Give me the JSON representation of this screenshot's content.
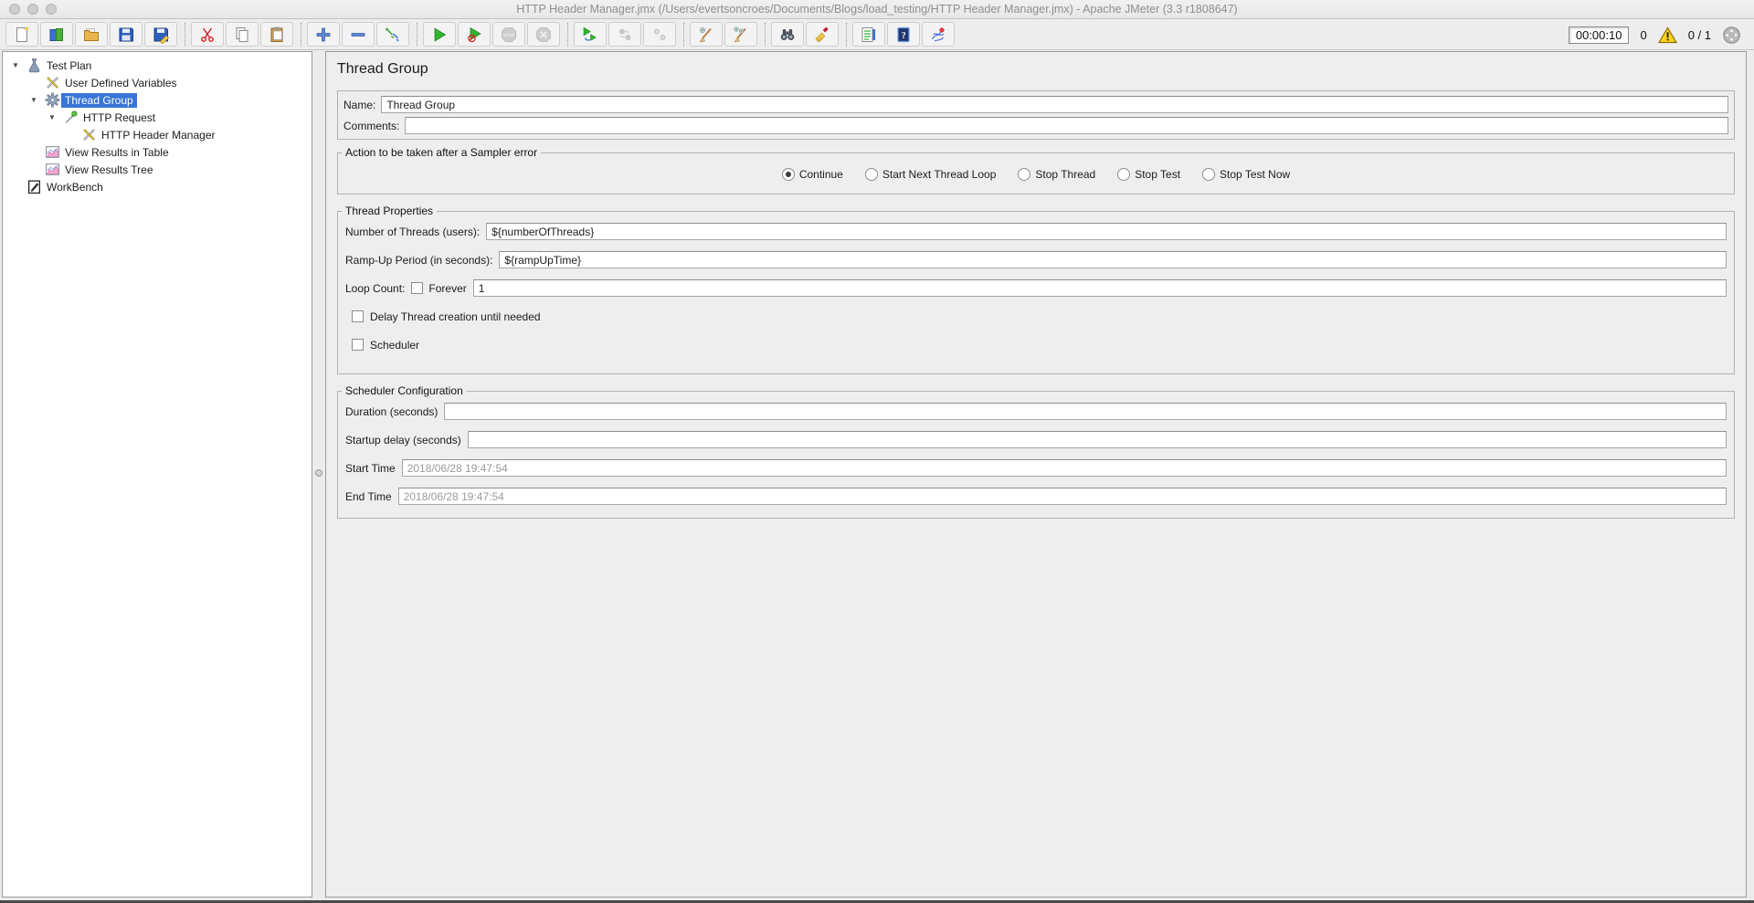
{
  "window": {
    "title": "HTTP Header Manager.jmx (/Users/evertsoncroes/Documents/Blogs/load_testing/HTTP Header Manager.jmx) - Apache JMeter (3.3 r1808647)",
    "controls": [
      "close",
      "minimize",
      "zoom"
    ]
  },
  "toolbar": {
    "buttons": [
      {
        "name": "new",
        "disabled": false
      },
      {
        "name": "templates",
        "disabled": false
      },
      {
        "name": "open",
        "disabled": false
      },
      {
        "name": "save",
        "disabled": false
      },
      {
        "name": "save-as",
        "disabled": false
      },
      {
        "name": "cut",
        "disabled": false
      },
      {
        "name": "copy",
        "disabled": false
      },
      {
        "name": "paste",
        "disabled": false
      },
      {
        "name": "expand-all",
        "disabled": false
      },
      {
        "name": "collapse-all",
        "disabled": false
      },
      {
        "name": "toggle",
        "disabled": false
      },
      {
        "name": "start",
        "disabled": false
      },
      {
        "name": "start-no-pauses",
        "disabled": false
      },
      {
        "name": "stop",
        "disabled": true
      },
      {
        "name": "shutdown",
        "disabled": true
      },
      {
        "name": "remote-start-all",
        "disabled": false
      },
      {
        "name": "remote-stop-all",
        "disabled": true
      },
      {
        "name": "remote-shutdown-all",
        "disabled": true
      },
      {
        "name": "clear",
        "disabled": false
      },
      {
        "name": "clear-all",
        "disabled": false
      },
      {
        "name": "search",
        "disabled": false
      },
      {
        "name": "search-reset",
        "disabled": false
      },
      {
        "name": "function-helper",
        "disabled": false
      },
      {
        "name": "help",
        "disabled": false
      },
      {
        "name": "molecule",
        "disabled": false
      }
    ],
    "status": {
      "elapsed_time": "00:00:10",
      "error_count": "0",
      "active_threads": "0 / 1"
    }
  },
  "tree": {
    "items": [
      {
        "label": "Test Plan",
        "icon": "test-plan-flask",
        "expanded": true,
        "selected": false
      },
      {
        "label": "User Defined Variables",
        "icon": "config-tools",
        "selected": false
      },
      {
        "label": "Thread Group",
        "icon": "thread-group-gear",
        "expanded": true,
        "selected": true
      },
      {
        "label": "HTTP Request",
        "icon": "http-request-dropper",
        "expanded": true,
        "selected": false
      },
      {
        "label": "HTTP Header Manager",
        "icon": "config-tools",
        "selected": false
      },
      {
        "label": "View Results in Table",
        "icon": "results-chart",
        "selected": false
      },
      {
        "label": "View Results Tree",
        "icon": "results-chart",
        "selected": false
      },
      {
        "label": "WorkBench",
        "icon": "workbench",
        "selected": false
      }
    ]
  },
  "main": {
    "title": "Thread Group",
    "name_label": "Name:",
    "name_value": "Thread Group",
    "comments_label": "Comments:",
    "comments_value": "",
    "action": {
      "legend": "Action to be taken after a Sampler error",
      "options": [
        {
          "label": "Continue",
          "selected": true
        },
        {
          "label": "Start Next Thread Loop",
          "selected": false
        },
        {
          "label": "Stop Thread",
          "selected": false
        },
        {
          "label": "Stop Test",
          "selected": false
        },
        {
          "label": "Stop Test Now",
          "selected": false
        }
      ]
    },
    "thread_properties": {
      "legend": "Thread Properties",
      "number_of_threads_label": "Number of Threads (users):",
      "number_of_threads_value": "${numberOfThreads}",
      "ramp_up_label": "Ramp-Up Period (in seconds):",
      "ramp_up_value": "${rampUpTime}",
      "loop_count_label": "Loop Count:",
      "forever_label": "Forever",
      "forever_checked": false,
      "loop_count_value": "1",
      "delay_label": "Delay Thread creation until needed",
      "delay_checked": false,
      "scheduler_label": "Scheduler",
      "scheduler_checked": false
    },
    "scheduler_configuration": {
      "legend": "Scheduler Configuration",
      "duration_label": "Duration (seconds)",
      "duration_value": "",
      "startup_delay_label": "Startup delay (seconds)",
      "startup_delay_value": "",
      "start_time_label": "Start Time",
      "start_time_value": "2018/06/28 19:47:54",
      "end_time_label": "End Time",
      "end_time_value": "2018/06/28 19:47:54"
    }
  }
}
